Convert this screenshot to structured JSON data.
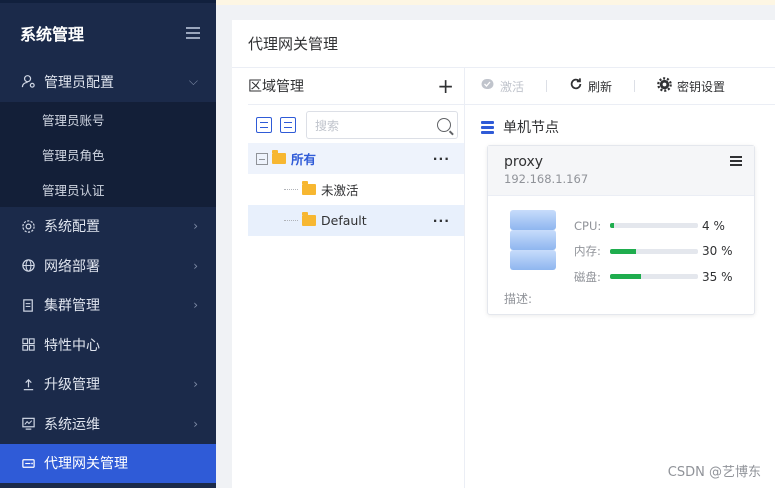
{
  "sidebar": {
    "title": "系统管理",
    "items": [
      {
        "label": "管理员配置",
        "icon": "user-settings-icon",
        "arrow": "⌵"
      },
      {
        "label": "系统配置",
        "icon": "gear-icon",
        "arrow": "›"
      },
      {
        "label": "网络部署",
        "icon": "globe-icon",
        "arrow": "›"
      },
      {
        "label": "集群管理",
        "icon": "cluster-icon",
        "arrow": "›"
      },
      {
        "label": "特性中心",
        "icon": "grid-icon",
        "arrow": ""
      },
      {
        "label": "升级管理",
        "icon": "upload-icon",
        "arrow": "›"
      },
      {
        "label": "系统运维",
        "icon": "monitor-icon",
        "arrow": "›"
      },
      {
        "label": "代理网关管理",
        "icon": "gateway-icon",
        "arrow": ""
      }
    ],
    "subitems": [
      "管理员账号",
      "管理员角色",
      "管理员认证"
    ]
  },
  "panel": {
    "title": "代理网关管理"
  },
  "zone": {
    "title": "区域管理",
    "add": "+",
    "search_placeholder": "搜索",
    "nodes": [
      {
        "label": "所有",
        "more": "···"
      },
      {
        "label": "未激活",
        "more": ""
      },
      {
        "label": "Default",
        "more": "···"
      }
    ]
  },
  "toolbar": {
    "activate": "激活",
    "refresh": "刷新",
    "key_settings": "密钥设置"
  },
  "section": {
    "title": "单机节点"
  },
  "card": {
    "name": "proxy",
    "ip": "192.168.1.167",
    "metrics": [
      {
        "label": "CPU:",
        "value": "4 %",
        "percent": 4
      },
      {
        "label": "内存:",
        "value": "30 %",
        "percent": 30
      },
      {
        "label": "磁盘:",
        "value": "35 %",
        "percent": 35
      }
    ],
    "desc_label": "描述:"
  },
  "watermark": "CSDN @艺博东",
  "colors": {
    "accent": "#2f5bd7",
    "sidebar_bg": "#1b2a4a",
    "bar_fill": "#1fad4e",
    "folder": "#f7b731"
  }
}
